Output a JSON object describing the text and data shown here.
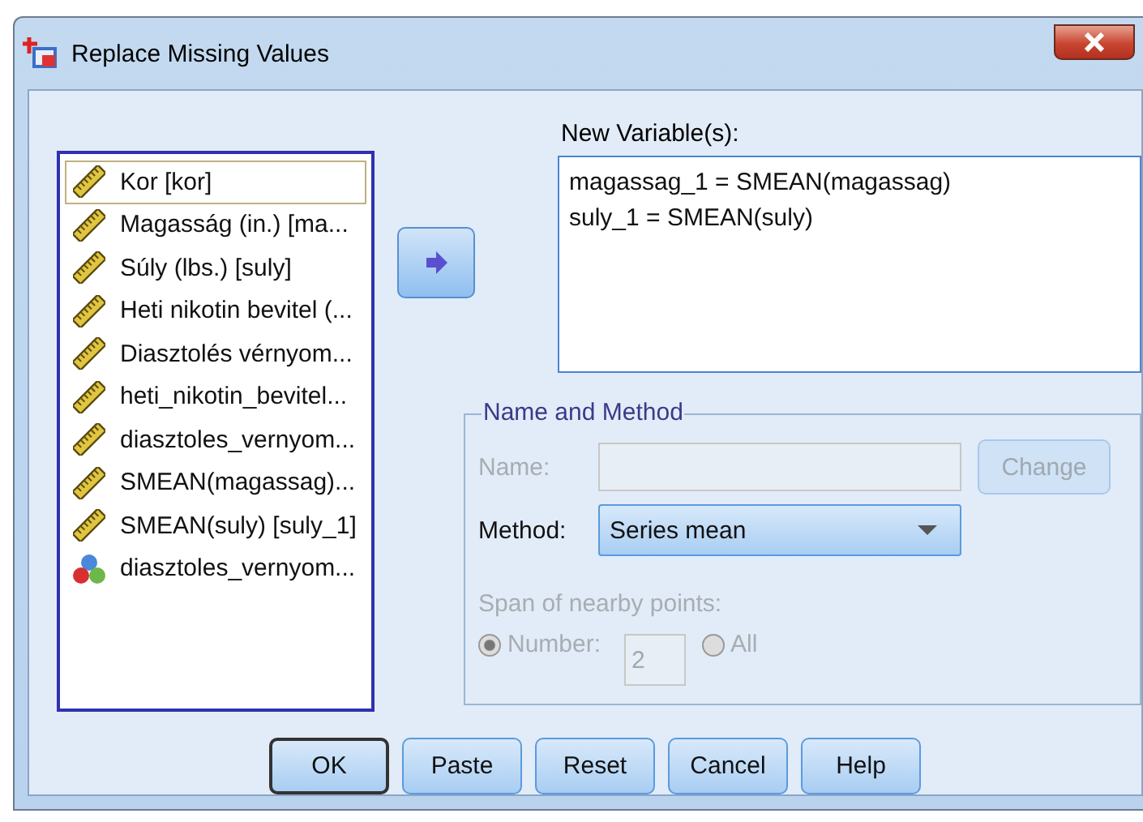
{
  "window": {
    "title": "Replace Missing Values"
  },
  "variables": [
    {
      "label": "Kor [kor]",
      "kind": "scale",
      "selected": true
    },
    {
      "label": "Magasság (in.) [ma...",
      "kind": "scale",
      "selected": false
    },
    {
      "label": "Súly (lbs.) [suly]",
      "kind": "scale",
      "selected": false
    },
    {
      "label": "Heti nikotin bevitel (...",
      "kind": "scale",
      "selected": false
    },
    {
      "label": "Diasztolés vérnyom...",
      "kind": "scale",
      "selected": false
    },
    {
      "label": "heti_nikotin_bevitel...",
      "kind": "scale",
      "selected": false
    },
    {
      "label": "diasztoles_vernyom...",
      "kind": "scale",
      "selected": false
    },
    {
      "label": "SMEAN(magassag)...",
      "kind": "scale",
      "selected": false
    },
    {
      "label": "SMEAN(suly) [suly_1]",
      "kind": "scale",
      "selected": false
    },
    {
      "label": "diasztoles_vernyom...",
      "kind": "nominal",
      "selected": false
    }
  ],
  "new_variables": {
    "label": "New Variable(s):",
    "lines": [
      "magassag_1 = SMEAN(magassag)",
      "suly_1 = SMEAN(suly)"
    ]
  },
  "name_and_method": {
    "title": "Name and Method",
    "name": {
      "label": "Name:",
      "disabled": true
    },
    "change_button": {
      "label": "Change",
      "disabled": true
    },
    "method": {
      "label": "Method:",
      "value": "Series mean",
      "disabled": false
    },
    "span": {
      "label": "Span of nearby points:",
      "disabled": true,
      "number": "2",
      "options": [
        {
          "label": "Number:",
          "selected": true
        },
        {
          "label": "All",
          "selected": false
        }
      ]
    }
  },
  "buttons": [
    {
      "label": "OK",
      "default": true
    },
    {
      "label": "Paste",
      "default": false
    },
    {
      "label": "Reset",
      "default": false
    },
    {
      "label": "Cancel",
      "default": false
    },
    {
      "label": "Help",
      "default": false
    }
  ]
}
